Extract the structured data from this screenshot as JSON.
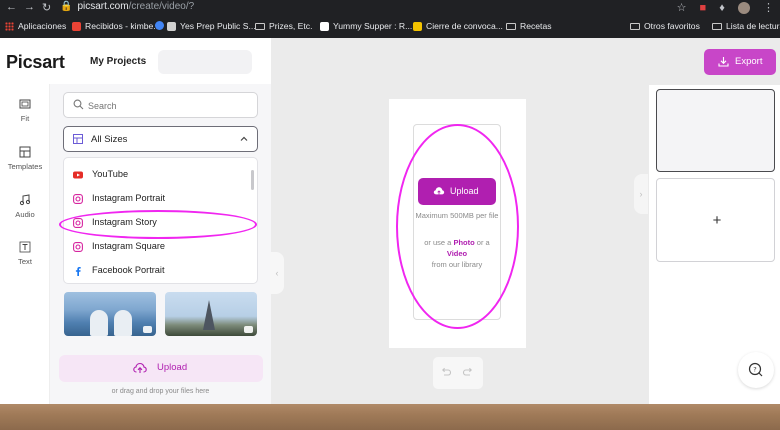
{
  "browser": {
    "url_host": "picsart.com",
    "url_path": "/create/video/?",
    "bookmarks": [
      {
        "label": "Aplicaciones",
        "icon": "apps-grid-icon",
        "color": "#ea4335"
      },
      {
        "label": "Recibidos - kimbe...",
        "icon": "gmail-icon",
        "color": "#ea4335"
      },
      {
        "label": "",
        "icon": "google-icon",
        "color": "#4285f4"
      },
      {
        "label": "Yes Prep Public S...",
        "icon": "yesprep-icon",
        "color": "#ffffff"
      },
      {
        "label": "Prizes, Etc.",
        "icon": "folder-icon",
        "color": "#c8c8c8"
      },
      {
        "label": "Yummy Supper : R...",
        "icon": "page-icon",
        "color": "#ffffff"
      },
      {
        "label": "Cierre de convoca...",
        "icon": "bookmark-yellow-icon",
        "color": "#f3c300"
      },
      {
        "label": "Recetas",
        "icon": "folder-icon",
        "color": "#c8c8c8"
      },
      {
        "label": "Otros favoritos",
        "icon": "folder-icon",
        "color": "#c8c8c8"
      },
      {
        "label": "Lista de lectura",
        "icon": "reading-list-icon",
        "color": "#c8c8c8"
      }
    ]
  },
  "header": {
    "logo": "Picsart",
    "my_projects": "My Projects",
    "export_label": "Export"
  },
  "rail": [
    {
      "label": "Fit",
      "icon": "fit-icon"
    },
    {
      "label": "Templates",
      "icon": "templates-icon"
    },
    {
      "label": "Audio",
      "icon": "audio-icon"
    },
    {
      "label": "Text",
      "icon": "text-icon"
    }
  ],
  "tools": {
    "search_placeholder": "Search",
    "size_selected": "All Sizes",
    "size_options": [
      {
        "label": "YouTube",
        "icon": "youtube-icon",
        "color": "#e52d27"
      },
      {
        "label": "Instagram Portrait",
        "icon": "instagram-icon",
        "color": "#d6249f"
      },
      {
        "label": "Instagram Story",
        "icon": "instagram-icon",
        "color": "#d6249f"
      },
      {
        "label": "Instagram Square",
        "icon": "instagram-icon",
        "color": "#d6249f"
      },
      {
        "label": "Facebook Portrait",
        "icon": "facebook-icon",
        "color": "#1877f2"
      }
    ],
    "upload_label": "Upload",
    "drag_hint": "or drag and drop your files here"
  },
  "canvas": {
    "upload_label": "Upload",
    "max_size": "Maximum 500MB per file",
    "use_prefix": "or use a",
    "photo": "Photo",
    "or": "or a",
    "video": "Video",
    "library": "from our library"
  },
  "scenes": {
    "add_label": "+"
  },
  "colors": {
    "accent": "#b01fb0",
    "export_bg": "#c846c8",
    "annotation": "#f026f0"
  }
}
